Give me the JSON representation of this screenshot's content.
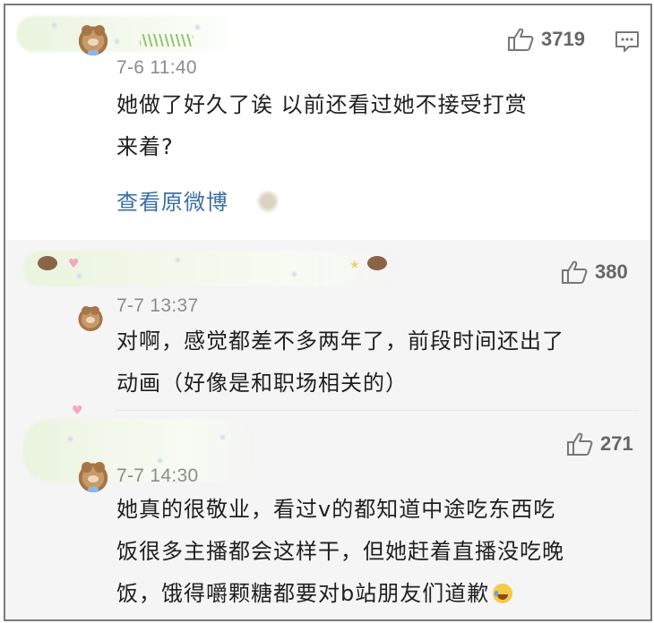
{
  "main_comment": {
    "timestamp": "7-6 11:40",
    "likes": "3719",
    "line1": "她做了好久了诶  以前还看过她不接受打赏",
    "line2": "来着?",
    "view_original": "查看原微博"
  },
  "replies": [
    {
      "timestamp": "7-7 13:37",
      "likes": "380",
      "line1": "对啊，感觉都差不多两年了，前段时间还出了",
      "line2": "动画（好像是和职场相关的）"
    },
    {
      "timestamp": "7-7 14:30",
      "likes": "271",
      "line1": "她真的很敬业，看过v的都知道中途吃东西吃",
      "line2": "饭很多主播都会这样干，但她赶着直播没吃晚",
      "line3": "饭，饿得嚼颗糖都要对b站朋友们道歉"
    }
  ],
  "icons": {
    "like": "thumbs-up-icon",
    "reply": "comment-icon",
    "emoji": "laugh-cry-emoji-icon",
    "avatar": "bear-avatar-icon"
  },
  "colors": {
    "link": "#3a6fa5",
    "timestamp": "#8c8c8c",
    "text": "#1f1f1f",
    "reply_bg": "#f5f5f5"
  }
}
